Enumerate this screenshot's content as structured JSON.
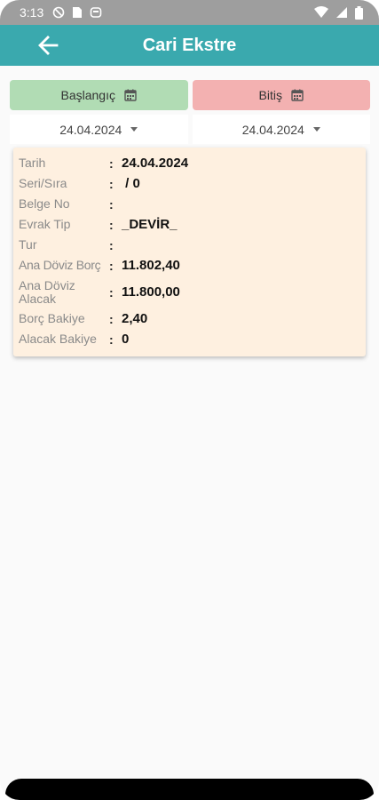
{
  "status_bar": {
    "time": "3:13"
  },
  "app_bar": {
    "title": "Cari Ekstre"
  },
  "date_filter": {
    "start_label": "Başlangıç",
    "end_label": "Bitiş",
    "start_value": "24.04.2024",
    "end_value": "24.04.2024"
  },
  "record": {
    "rows": [
      {
        "label": "Tarih",
        "value": "24.04.2024"
      },
      {
        "label": "Seri/Sıra",
        "value": " / 0"
      },
      {
        "label": "Belge No",
        "value": ""
      },
      {
        "label": "Evrak Tip",
        "value": "_DEVİR_"
      },
      {
        "label": "Tur",
        "value": ""
      },
      {
        "label": "Ana Döviz Borç",
        "value": "11.802,40"
      },
      {
        "label": "Ana Döviz Alacak",
        "value": "11.800,00"
      },
      {
        "label": "Borç Bakiye",
        "value": "2,40"
      },
      {
        "label": "Alacak Bakiye",
        "value": "0"
      }
    ]
  },
  "colors": {
    "app_bar": "#3aa9ae",
    "start_button": "#b1dcb4",
    "end_button": "#f3b1b1",
    "card_background": "#fef0e0"
  }
}
